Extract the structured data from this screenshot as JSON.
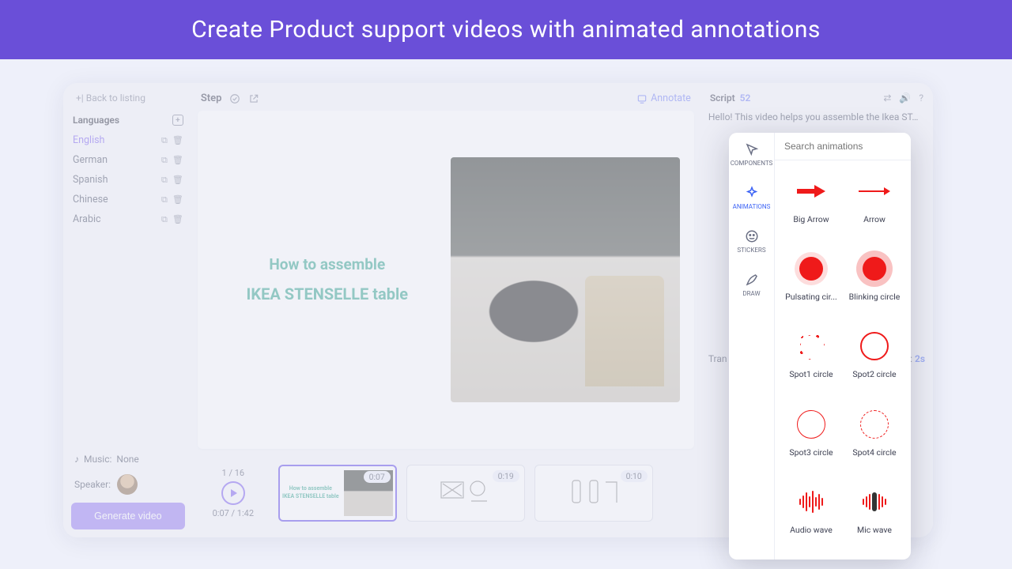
{
  "banner": "Create Product support videos with animated annotations",
  "back_link": "+| Back to listing",
  "languages": {
    "header": "Languages",
    "items": [
      "English",
      "German",
      "Spanish",
      "Chinese",
      "Arabic"
    ]
  },
  "music": {
    "label": "Music:",
    "value": "None"
  },
  "speaker_label": "Speaker:",
  "generate_button": "Generate video",
  "step": {
    "title": "Step"
  },
  "annotate_label": "Annotate",
  "canvas": {
    "line1": "How to assemble",
    "line2": "IKEA STENSELLE table"
  },
  "timeline": {
    "counter": "1 / 16",
    "time": "0:07 / 1:42",
    "thumbs": [
      {
        "badge": "0:07"
      },
      {
        "badge": "0:19"
      },
      {
        "badge": "0:10"
      }
    ]
  },
  "script": {
    "header": "Script",
    "count": "52",
    "body": "Hello! This video helps you assemble the Ikea ST…"
  },
  "transition": {
    "label_left": "Tran",
    "label_right_prefix": "e:",
    "value": "2s"
  },
  "anim_panel": {
    "search_placeholder": "Search animations",
    "tabs": [
      "COMPONENTS",
      "ANIMATIONS",
      "STICKERS",
      "DRAW"
    ],
    "items": [
      "Big Arrow",
      "Arrow",
      "Pulsating cir...",
      "Blinking circle",
      "Spot1 circle",
      "Spot2 circle",
      "Spot3 circle",
      "Spot4 circle",
      "Audio wave",
      "Mic wave"
    ]
  }
}
